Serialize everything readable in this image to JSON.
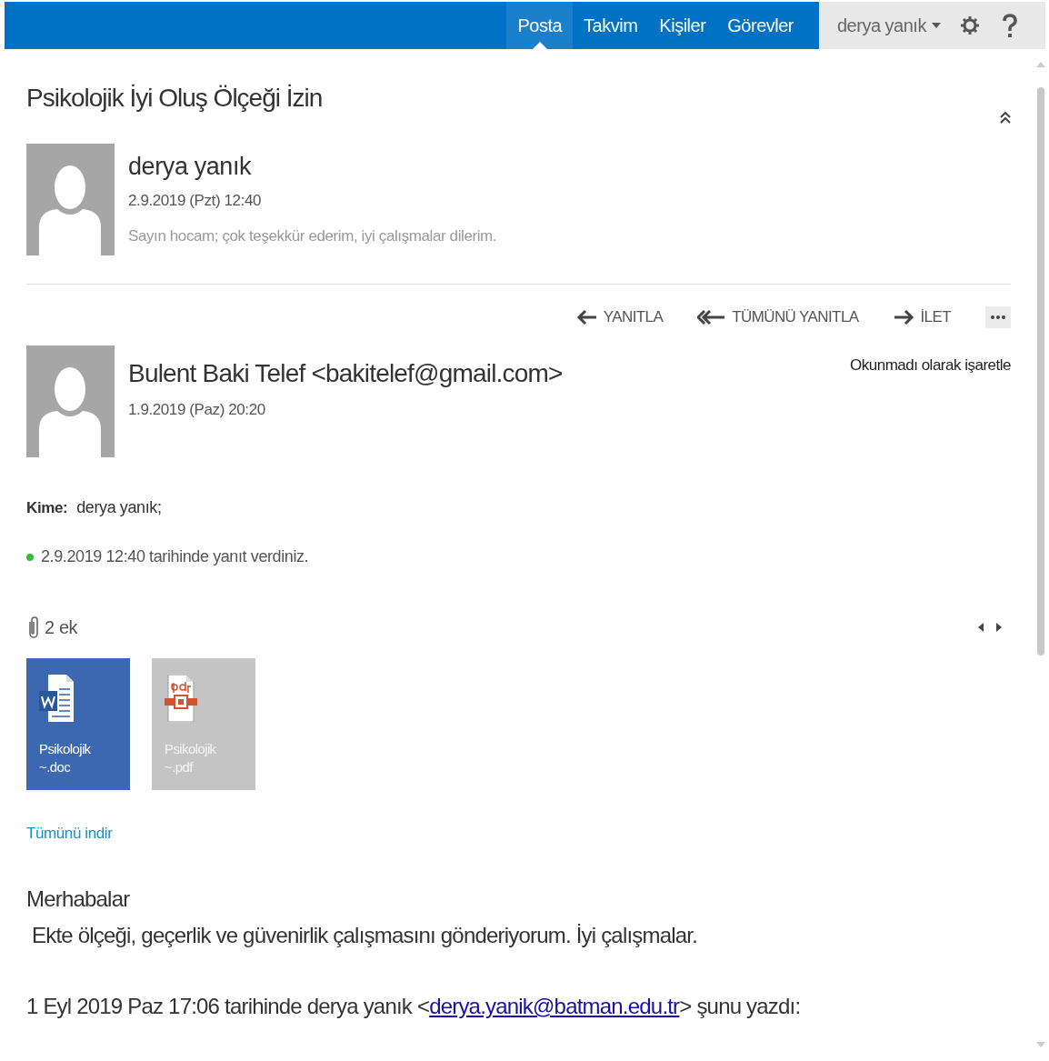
{
  "nav": {
    "items": [
      {
        "label": "Posta",
        "selected": true
      },
      {
        "label": "Takvim",
        "selected": false
      },
      {
        "label": "Kişiler",
        "selected": false
      },
      {
        "label": "Görevler",
        "selected": false
      }
    ],
    "user": "derya yanık"
  },
  "subject": "Psikolojik İyi Oluş Ölçeği İzin",
  "reply": {
    "sender": "derya yanık",
    "date": "2.9.2019 (Pzt) 12:40",
    "preview": "Sayın hocam; çok teşekkür ederim, iyi çalışmalar dilerim."
  },
  "actions": [
    {
      "kind": "reply",
      "label": "YANITLA"
    },
    {
      "kind": "reply_all",
      "label": "TÜMÜNÜ YANITLA"
    },
    {
      "kind": "forward",
      "label": "İLET"
    },
    {
      "kind": "more"
    }
  ],
  "message": {
    "sender": "Bulent Baki Telef <bakitelef@gmail.com>",
    "date": "1.9.2019 (Paz) 20:20",
    "mark_unread": "Okunmadı olarak işaretle",
    "to_label": "Kime:",
    "to": "derya yanık;",
    "reply_note": "2.9.2019 12:40 tarihinde yanıt verdiniz.",
    "attachments_count": "2 ek",
    "attachments": [
      {
        "kind": "word",
        "lines": [
          "Psikolojik",
          "~.doc"
        ]
      },
      {
        "kind": "pdf",
        "lines": [
          "Psikolojik",
          "~.pdf"
        ]
      }
    ],
    "download_all": "Tümünü indir",
    "body": {
      "greeting": "Merhabalar",
      "text": "Ekte ölçeği, geçerlik ve güvenirlik çalışmasını gönderiyorum. İyi çalışmalar.",
      "quote_prefix": "1 Eyl 2019 Paz 17:06 tarihinde derya yanık <",
      "quote_link": "derya.yanik@batman.edu.tr",
      "quote_suffix": "> şunu yazdı:"
    }
  }
}
